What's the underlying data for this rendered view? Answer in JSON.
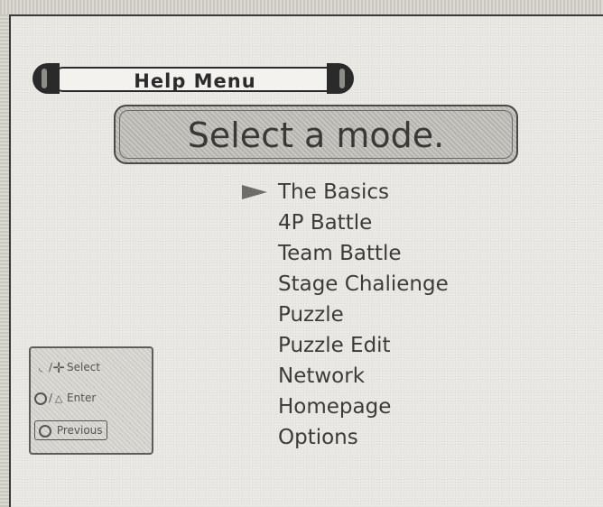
{
  "help_bar": {
    "title": "Help Menu"
  },
  "banner": {
    "text": "Select a mode."
  },
  "menu": {
    "selected_index": 0,
    "items": [
      "The Basics",
      "4P Battle",
      "Team Battle",
      "Stage Chalienge",
      "Puzzle",
      "Puzzle Edit",
      "Network",
      "Homepage",
      "Options"
    ]
  },
  "legend": {
    "select": {
      "sep": "/",
      "label": "Select",
      "icons": [
        "analog-stick-icon",
        "dpad-icon"
      ]
    },
    "enter": {
      "sep": "/",
      "label": "Enter",
      "icons": [
        "circle-button-icon",
        "triangle-button-icon"
      ]
    },
    "previous": {
      "label": "Previous",
      "icons": [
        "back-button-icon"
      ]
    }
  },
  "colors": {
    "background": "#eceae5",
    "text": "#3c3b38",
    "banner_fill": "#bdbbb6",
    "cursor": "#6f6d69"
  }
}
